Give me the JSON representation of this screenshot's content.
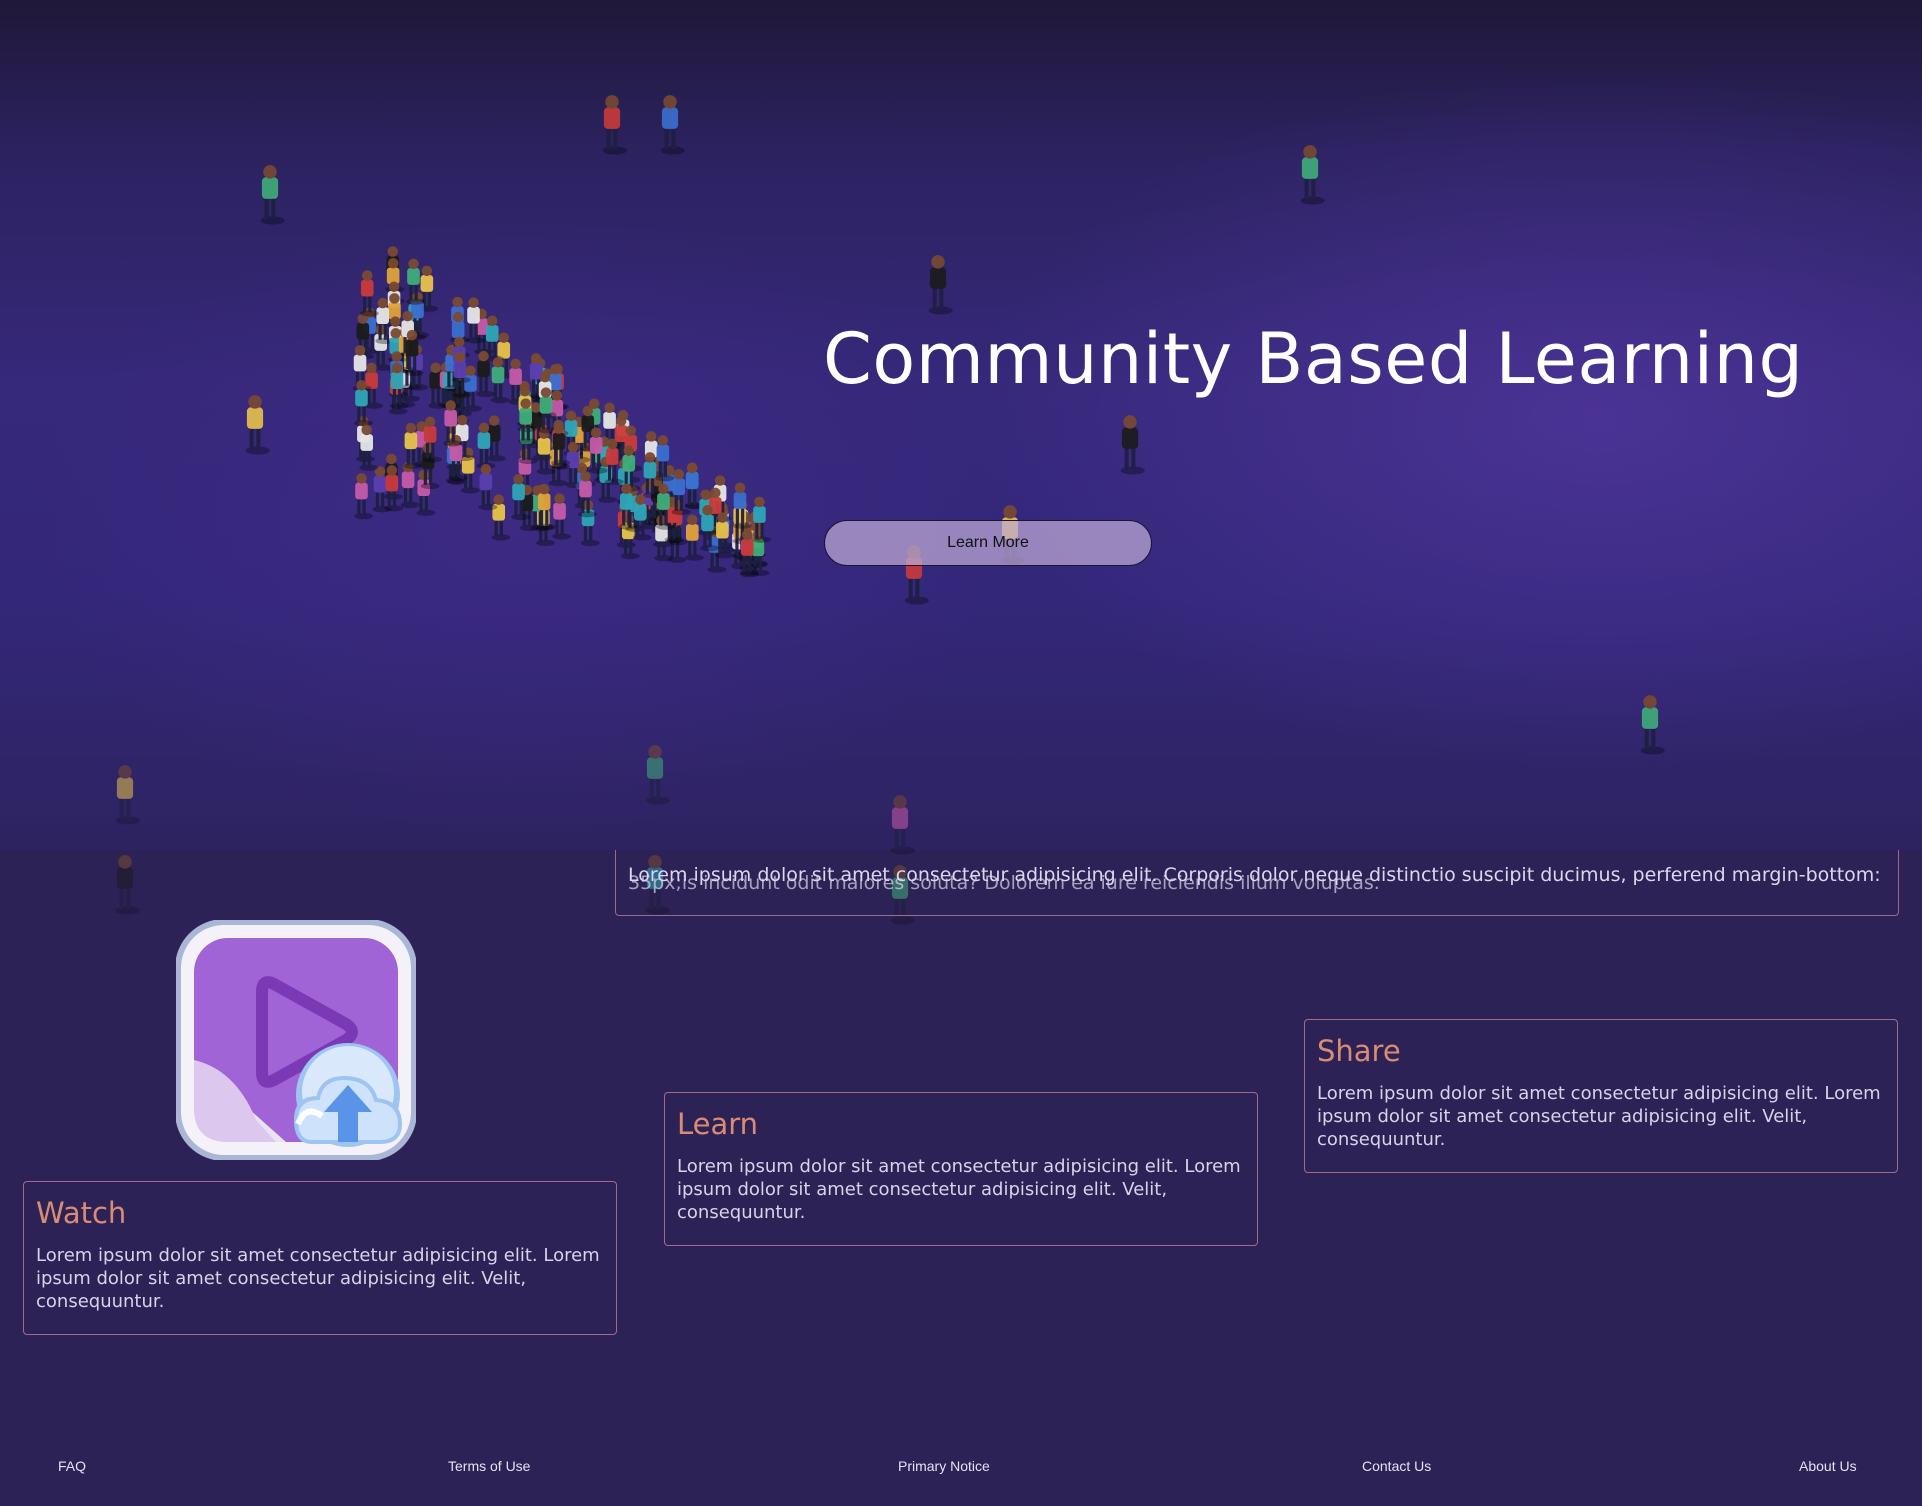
{
  "hero": {
    "title": "Community Based Learning",
    "cta_label": "Learn More"
  },
  "intro": {
    "text": "Lorem ipsum dolor sit amet consectetur adipisicing elit. Corporis dolor neque distinctio suscipit ducimus, perferend margin-bottom:",
    "text_overlap": "35px;is incidunt odit maiores soluta? Dolorem ea iure reiciendis illum voluptas."
  },
  "app_icon": {
    "name": "video-upload-icon"
  },
  "features": [
    {
      "title": "Watch",
      "body": "Lorem ipsum dolor sit amet consectetur adipisicing elit. Lorem ipsum dolor sit amet consectetur adipisicing elit. Velit, consequuntur."
    },
    {
      "title": "Learn",
      "body": "Lorem ipsum dolor sit amet consectetur adipisicing elit. Lorem ipsum dolor sit amet consectetur adipisicing elit. Velit, consequuntur."
    },
    {
      "title": "Share",
      "body": "Lorem ipsum dolor sit amet consectetur adipisicing elit. Lorem ipsum dolor sit amet consectetur adipisicing elit. Velit, consequuntur."
    }
  ],
  "footer": {
    "links": [
      "FAQ",
      "Terms of Use",
      "Primary Notice",
      "Contact Us",
      "About Us"
    ]
  },
  "colors": {
    "background": "#2d2255",
    "hero_accent": "#36287a",
    "card_border": "#a06c8a",
    "card_title": "#d98c73",
    "button_bg": "#bfaad7"
  }
}
